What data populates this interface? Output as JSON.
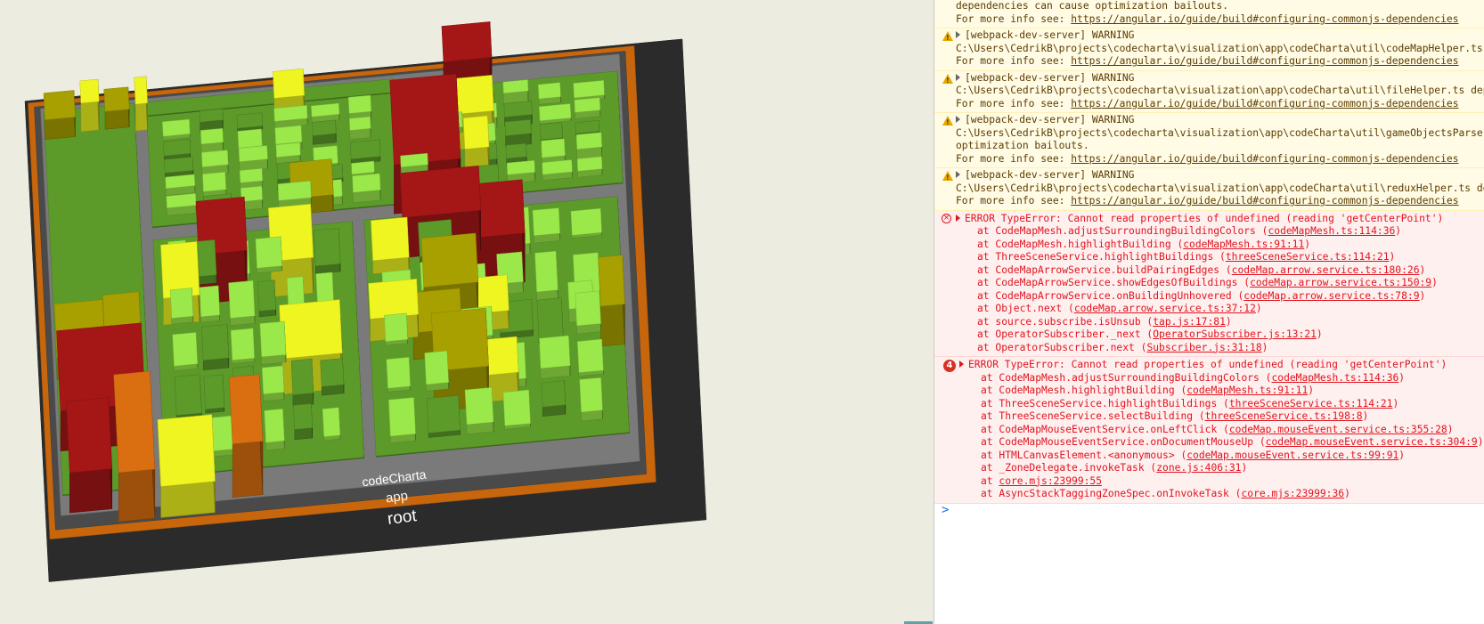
{
  "app": {
    "name": "CodeCharta"
  },
  "map": {
    "labels": [
      "codeCharta",
      "app",
      "root"
    ],
    "colors": {
      "background": "#ecede0",
      "root_base": "#2b2b2b",
      "root_rim": "#c7660d",
      "folder_dark": "#4a4a4a",
      "folder_mid": "#7a7a7a",
      "building_green": "#5c9a2a",
      "building_light_green": "#9ae84a",
      "building_yellow": "#eef520",
      "building_olive": "#a8a000",
      "building_red": "#a51616",
      "building_orange": "#d96f10"
    }
  },
  "console": {
    "entries": [
      {
        "type": "warning",
        "truncated": true,
        "lines": [
          {
            "text": "dependencies can cause optimization bailouts."
          },
          {
            "text": "For more info see: ",
            "link": "https://angular.io/guide/build#configuring-commonjs-dependencies"
          }
        ]
      },
      {
        "type": "warning",
        "lines": [
          {
            "text": "[webpack-dev-server] WARNING",
            "toggle": true
          },
          {
            "text": "C:\\Users\\CedrikB\\projects\\codecharta\\visualization\\app\\codeCharta\\util\\codeMapHelper.ts dependencies"
          },
          {
            "text": "For more info see: ",
            "link": "https://angular.io/guide/build#configuring-commonjs-dependencies"
          }
        ]
      },
      {
        "type": "warning",
        "lines": [
          {
            "text": "[webpack-dev-server] WARNING",
            "toggle": true
          },
          {
            "text": "C:\\Users\\CedrikB\\projects\\codecharta\\visualization\\app\\codeCharta\\util\\fileHelper.ts dependencies"
          },
          {
            "text": "For more info see: ",
            "link": "https://angular.io/guide/build#configuring-commonjs-dependencies"
          }
        ]
      },
      {
        "type": "warning",
        "lines": [
          {
            "text": "[webpack-dev-server] WARNING",
            "toggle": true
          },
          {
            "text": "C:\\Users\\CedrikB\\projects\\codecharta\\visualization\\app\\codeCharta\\util\\gameObjectsParser\\gameObjectsParser.ts"
          },
          {
            "text": "optimization bailouts."
          },
          {
            "text": "For more info see: ",
            "link": "https://angular.io/guide/build#configuring-commonjs-dependencies"
          }
        ]
      },
      {
        "type": "warning",
        "lines": [
          {
            "text": "[webpack-dev-server] WARNING",
            "toggle": true
          },
          {
            "text": "C:\\Users\\CedrikB\\projects\\codecharta\\visualization\\app\\codeCharta\\util\\reduxHelper.ts dependencies"
          },
          {
            "text": "For more info see: ",
            "link": "https://angular.io/guide/build#configuring-commonjs-dependencies"
          }
        ]
      },
      {
        "type": "error",
        "lines": [
          {
            "text": "ERROR TypeError: Cannot read properties of undefined (reading 'getCenterPoint')",
            "toggle": true
          },
          {
            "text": "at CodeMapMesh.adjustSurroundingBuildingColors (",
            "link": "codeMapMesh.ts:114:36",
            "after": ")",
            "stack": true
          },
          {
            "text": "at CodeMapMesh.highlightBuilding (",
            "link": "codeMapMesh.ts:91:11",
            "after": ")",
            "stack": true
          },
          {
            "text": "at ThreeSceneService.highlightBuildings (",
            "link": "threeSceneService.ts:114:21",
            "after": ")",
            "stack": true
          },
          {
            "text": "at CodeMapArrowService.buildPairingEdges (",
            "link": "codeMap.arrow.service.ts:180:26",
            "after": ")",
            "stack": true
          },
          {
            "text": "at CodeMapArrowService.showEdgesOfBuildings (",
            "link": "codeMap.arrow.service.ts:150:9",
            "after": ")",
            "stack": true
          },
          {
            "text": "at CodeMapArrowService.onBuildingUnhovered (",
            "link": "codeMap.arrow.service.ts:78:9",
            "after": ")",
            "stack": true
          },
          {
            "text": "at Object.next (",
            "link": "codeMap.arrow.service.ts:37:12",
            "after": ")",
            "stack": true
          },
          {
            "text": "at source.subscribe.isUnsub (",
            "link": "tap.js:17:81",
            "after": ")",
            "stack": true
          },
          {
            "text": "at OperatorSubscriber._next (",
            "link": "OperatorSubscriber.js:13:21",
            "after": ")",
            "stack": true
          },
          {
            "text": "at OperatorSubscriber.next (",
            "link": "Subscriber.js:31:18",
            "after": ")",
            "stack": true
          }
        ]
      },
      {
        "type": "error",
        "count": "4",
        "lines": [
          {
            "text": "ERROR TypeError: Cannot read properties of undefined (reading 'getCenterPoint')",
            "toggle": true
          },
          {
            "text": "at CodeMapMesh.adjustSurroundingBuildingColors (",
            "link": "codeMapMesh.ts:114:36",
            "after": ")",
            "stack": true
          },
          {
            "text": "at CodeMapMesh.highlightBuilding (",
            "link": "codeMapMesh.ts:91:11",
            "after": ")",
            "stack": true
          },
          {
            "text": "at ThreeSceneService.highlightBuildings (",
            "link": "threeSceneService.ts:114:21",
            "after": ")",
            "stack": true
          },
          {
            "text": "at ThreeSceneService.selectBuilding (",
            "link": "threeSceneService.ts:198:8",
            "after": ")",
            "stack": true
          },
          {
            "text": "at CodeMapMouseEventService.onLeftClick (",
            "link": "codeMap.mouseEvent.service.ts:355:28",
            "after": ")",
            "stack": true
          },
          {
            "text": "at CodeMapMouseEventService.onDocumentMouseUp (",
            "link": "codeMap.mouseEvent.service.ts:304:9",
            "after": ")",
            "stack": true
          },
          {
            "text": "at HTMLCanvasElement.<anonymous> (",
            "link": "codeMap.mouseEvent.service.ts:99:91",
            "after": ")",
            "stack": true
          },
          {
            "text": "at _ZoneDelegate.invokeTask (",
            "link": "zone.js:406:31",
            "after": ")",
            "stack": true
          },
          {
            "text": "at ",
            "link": "core.mjs:23999:55",
            "after": "",
            "stack": true
          },
          {
            "text": "at AsyncStackTaggingZoneSpec.onInvokeTask (",
            "link": "core.mjs:23999:36",
            "after": ")",
            "stack": true
          }
        ]
      }
    ],
    "prompt_symbol": ">"
  }
}
